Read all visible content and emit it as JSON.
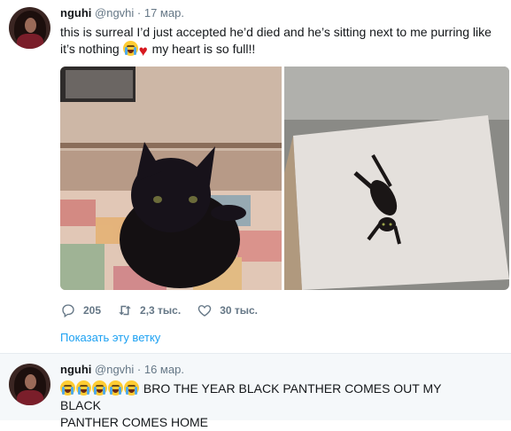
{
  "tweets": [
    {
      "name": "nguhi",
      "handle": "@ngvhi",
      "date": "· 17 мар.",
      "text_line1": "this is surreal I’d just accepted he’d died and he’s sitting next to me purring like",
      "text_line2_a": "it’s nothing",
      "text_line2_b": "my heart is so full!!",
      "emojis": [
        "loudly-crying-face",
        "red-heart"
      ],
      "actions": {
        "reply": {
          "icon": "reply-icon",
          "count": "205"
        },
        "retweet": {
          "icon": "retweet-icon",
          "count": "2,3 тыс."
        },
        "like": {
          "icon": "heart-outline-icon",
          "count": "30 тыс."
        }
      },
      "show_thread": "Показать эту ветку"
    },
    {
      "name": "nguhi",
      "handle": "@ngvhi",
      "date": "· 16 мар.",
      "emojis": [
        "loudly-crying-face",
        "loudly-crying-face",
        "loudly-crying-face",
        "loudly-crying-face",
        "loudly-crying-face"
      ],
      "text_a": "BRO THE YEAR BLACK PANTHER COMES OUT MY BLACK",
      "text_b": "PANTHER COMES HOME"
    }
  ],
  "colors": {
    "link": "#1da1f2",
    "secondary_text": "#657786",
    "primary_text": "#14171a",
    "thread_background": "#f5f8fa"
  }
}
